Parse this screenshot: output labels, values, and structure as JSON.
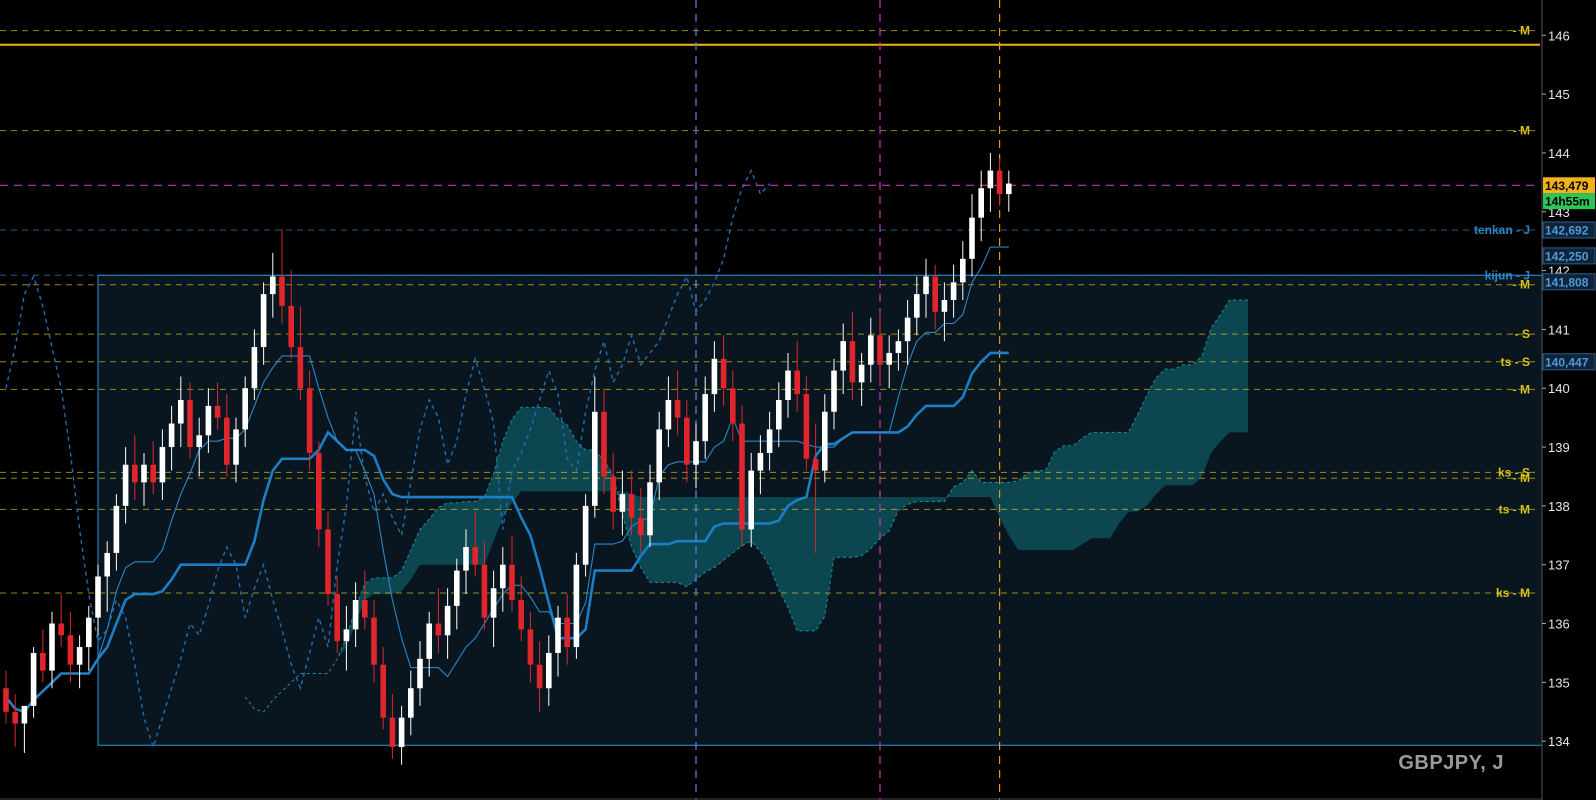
{
  "chart": {
    "symbol": "GBPJPY, J",
    "colors": {
      "background": "#000000",
      "bull": "#ffffff",
      "bear": "#e0262c",
      "kumo": "#0e6f78",
      "kijun": "#1a7fc4",
      "tenkan": "#2a86c8",
      "chikou": "#1f6fb5",
      "range_box": "#1f7fb8",
      "resistance": "#f3b21a"
    },
    "y_axis": {
      "min": 133.0,
      "max": 146.6,
      "ticks": [
        "146",
        "145",
        "144",
        "143",
        "142",
        "141",
        "140",
        "139",
        "138",
        "137",
        "136",
        "135",
        "134"
      ]
    },
    "price_tags": [
      {
        "text": "143,479",
        "value": 143.45,
        "bg": "#f3b21a",
        "fg": "#000000"
      },
      {
        "text": "14h55m",
        "value": 143.18,
        "bg": "#2fc45a",
        "fg": "#000000"
      },
      {
        "text": "142,692",
        "value": 142.69,
        "bg": "#10233a",
        "fg": "#4d9bd8"
      },
      {
        "text": "142,250",
        "value": 142.25,
        "bg": "#10233a",
        "fg": "#4d9bd8"
      },
      {
        "text": "141,808",
        "value": 141.81,
        "bg": "#10233a",
        "fg": "#4d9bd8"
      },
      {
        "text": "140,447",
        "value": 140.45,
        "bg": "#10233a",
        "fg": "#4d9bd8"
      }
    ],
    "levels": [
      {
        "label": "- M",
        "value": 146.08,
        "color": "#d9c21a"
      },
      {
        "label": "- M",
        "value": 144.38,
        "color": "#d9c21a"
      },
      {
        "label": "tenkan - J",
        "value": 142.69,
        "color": "#2a86c8"
      },
      {
        "label": "kijun - J",
        "value": 141.92,
        "color": "#2a86c8"
      },
      {
        "label": "- M",
        "value": 141.76,
        "color": "#d9c21a"
      },
      {
        "label": "- S",
        "value": 140.92,
        "color": "#d9c21a"
      },
      {
        "label": "ts - S",
        "value": 140.45,
        "color": "#d9c21a"
      },
      {
        "label": "- M",
        "value": 139.98,
        "color": "#d9c21a"
      },
      {
        "label": "ks - S",
        "value": 138.57,
        "color": "#d9c21a"
      },
      {
        "label": "- M",
        "value": 138.47,
        "color": "#d9c21a"
      },
      {
        "label": "ts - M",
        "value": 137.94,
        "color": "#d9c21a"
      },
      {
        "label": "ks - M",
        "value": 136.52,
        "color": "#d9c21a"
      }
    ],
    "resistance_line": 145.84,
    "magenta_hline": 143.45,
    "vlines": [
      {
        "bar": 75,
        "color": "#6a7fd8"
      },
      {
        "bar": 95,
        "color": "#d030c0"
      },
      {
        "bar": 108,
        "color": "#e39a1c"
      }
    ],
    "range_box": {
      "bar_start": 10,
      "bar_end": 168,
      "top": 141.92,
      "bottom": 133.93
    },
    "kijun_tail": {
      "bar_start": 106,
      "bar_end": 113,
      "value": 141.81
    },
    "tenkan_tail": {
      "bar_start": 111,
      "bar_end": 113,
      "value": 142.69
    }
  },
  "chart_data": {
    "type": "candlestick",
    "title": "GBPJPY, J",
    "ylim": [
      133.0,
      146.6
    ],
    "y_ticks": [
      134,
      135,
      136,
      137,
      138,
      139,
      140,
      141,
      142,
      143,
      144,
      145,
      146
    ],
    "x_labels": [],
    "last_price": 143.479,
    "candles": [
      [
        134.9,
        135.2,
        134.3,
        134.5
      ],
      [
        134.5,
        134.8,
        133.9,
        134.3
      ],
      [
        134.3,
        134.6,
        133.8,
        134.6
      ],
      [
        134.6,
        135.6,
        134.4,
        135.5
      ],
      [
        135.5,
        135.9,
        135.0,
        135.2
      ],
      [
        135.2,
        136.2,
        134.9,
        136.0
      ],
      [
        136.0,
        136.5,
        135.6,
        135.8
      ],
      [
        135.8,
        136.2,
        135.0,
        135.3
      ],
      [
        135.3,
        135.8,
        134.9,
        135.6
      ],
      [
        135.6,
        136.3,
        135.2,
        136.1
      ],
      [
        136.1,
        137.0,
        135.8,
        136.8
      ],
      [
        136.8,
        137.4,
        136.2,
        137.2
      ],
      [
        137.2,
        138.2,
        136.9,
        138.0
      ],
      [
        138.0,
        139.0,
        137.7,
        138.7
      ],
      [
        138.7,
        139.2,
        138.1,
        138.4
      ],
      [
        138.4,
        138.9,
        138.0,
        138.7
      ],
      [
        138.7,
        139.1,
        138.2,
        138.4
      ],
      [
        138.4,
        139.3,
        138.1,
        139.0
      ],
      [
        139.0,
        139.7,
        138.6,
        139.4
      ],
      [
        139.4,
        140.2,
        139.0,
        139.8
      ],
      [
        139.8,
        140.1,
        138.8,
        139.0
      ],
      [
        139.0,
        139.5,
        138.5,
        139.2
      ],
      [
        139.2,
        140.0,
        138.9,
        139.7
      ],
      [
        139.7,
        140.1,
        139.3,
        139.5
      ],
      [
        139.5,
        139.9,
        138.5,
        138.7
      ],
      [
        138.7,
        139.5,
        138.4,
        139.3
      ],
      [
        139.3,
        140.2,
        139.0,
        140.0
      ],
      [
        140.0,
        141.0,
        139.8,
        140.7
      ],
      [
        140.7,
        141.8,
        140.4,
        141.6
      ],
      [
        141.6,
        142.3,
        141.2,
        141.9
      ],
      [
        141.9,
        142.7,
        141.1,
        141.4
      ],
      [
        141.4,
        142.0,
        140.5,
        140.7
      ],
      [
        140.7,
        141.4,
        139.8,
        140.0
      ],
      [
        140.0,
        140.3,
        138.6,
        138.9
      ],
      [
        138.9,
        139.1,
        137.3,
        137.6
      ],
      [
        137.6,
        137.9,
        136.3,
        136.5
      ],
      [
        136.5,
        136.8,
        135.5,
        135.7
      ],
      [
        135.7,
        136.3,
        135.2,
        135.9
      ],
      [
        135.9,
        136.7,
        135.6,
        136.4
      ],
      [
        136.4,
        136.9,
        135.9,
        136.1
      ],
      [
        136.1,
        136.4,
        135.0,
        135.3
      ],
      [
        135.3,
        135.6,
        134.2,
        134.4
      ],
      [
        134.4,
        134.8,
        133.7,
        133.9
      ],
      [
        133.9,
        134.6,
        133.6,
        134.4
      ],
      [
        134.4,
        135.2,
        134.1,
        134.9
      ],
      [
        134.9,
        135.7,
        134.6,
        135.4
      ],
      [
        135.4,
        136.2,
        135.1,
        136.0
      ],
      [
        136.0,
        136.6,
        135.5,
        135.8
      ],
      [
        135.8,
        136.6,
        135.4,
        136.3
      ],
      [
        136.3,
        137.1,
        135.9,
        136.9
      ],
      [
        136.9,
        137.6,
        136.5,
        137.3
      ],
      [
        137.3,
        137.9,
        136.8,
        137.0
      ],
      [
        137.0,
        137.4,
        135.9,
        136.1
      ],
      [
        136.1,
        136.9,
        135.6,
        136.6
      ],
      [
        136.6,
        137.3,
        136.2,
        137.0
      ],
      [
        137.0,
        137.5,
        136.2,
        136.4
      ],
      [
        136.4,
        136.8,
        135.7,
        135.9
      ],
      [
        135.9,
        136.2,
        135.0,
        135.3
      ],
      [
        135.3,
        135.7,
        134.5,
        134.9
      ],
      [
        134.9,
        135.8,
        134.6,
        135.5
      ],
      [
        135.5,
        136.3,
        135.1,
        136.1
      ],
      [
        136.1,
        136.5,
        135.3,
        135.6
      ],
      [
        135.6,
        137.2,
        135.4,
        137.0
      ],
      [
        137.0,
        138.2,
        136.8,
        138.0
      ],
      [
        138.0,
        140.2,
        137.8,
        139.6
      ],
      [
        139.6,
        140.0,
        138.2,
        138.5
      ],
      [
        138.5,
        138.9,
        137.6,
        137.9
      ],
      [
        137.9,
        138.6,
        137.5,
        138.2
      ],
      [
        138.2,
        138.6,
        137.5,
        137.8
      ],
      [
        137.8,
        138.3,
        137.2,
        137.5
      ],
      [
        137.5,
        138.7,
        137.3,
        138.4
      ],
      [
        138.4,
        139.6,
        138.1,
        139.3
      ],
      [
        139.3,
        140.2,
        139.0,
        139.8
      ],
      [
        139.8,
        140.3,
        139.2,
        139.5
      ],
      [
        139.5,
        139.8,
        138.4,
        138.7
      ],
      [
        138.7,
        139.4,
        138.3,
        139.1
      ],
      [
        139.1,
        140.2,
        138.8,
        139.9
      ],
      [
        139.9,
        140.8,
        139.6,
        140.5
      ],
      [
        140.5,
        140.9,
        139.7,
        140.0
      ],
      [
        140.0,
        140.3,
        139.1,
        139.4
      ],
      [
        139.4,
        139.7,
        137.3,
        137.6
      ],
      [
        137.6,
        138.9,
        137.3,
        138.6
      ],
      [
        138.6,
        139.2,
        138.2,
        138.9
      ],
      [
        138.9,
        139.6,
        138.6,
        139.3
      ],
      [
        139.3,
        140.1,
        139.0,
        139.8
      ],
      [
        139.8,
        140.6,
        139.5,
        140.3
      ],
      [
        140.3,
        140.8,
        139.6,
        139.9
      ],
      [
        139.9,
        140.2,
        138.6,
        138.8
      ],
      [
        138.8,
        139.4,
        137.2,
        138.6
      ],
      [
        138.6,
        139.9,
        138.4,
        139.6
      ],
      [
        139.6,
        140.5,
        139.3,
        140.3
      ],
      [
        140.3,
        141.1,
        139.9,
        140.8
      ],
      [
        140.8,
        141.3,
        139.8,
        140.1
      ],
      [
        140.1,
        140.6,
        139.7,
        140.4
      ],
      [
        140.4,
        141.2,
        140.1,
        140.9
      ],
      [
        140.9,
        141.3,
        140.1,
        140.4
      ],
      [
        140.4,
        140.9,
        140.0,
        140.6
      ],
      [
        140.6,
        141.0,
        140.3,
        140.8
      ],
      [
        140.8,
        141.5,
        140.4,
        141.2
      ],
      [
        141.2,
        141.9,
        140.9,
        141.6
      ],
      [
        141.6,
        142.2,
        141.2,
        141.9
      ],
      [
        141.9,
        142.1,
        141.0,
        141.3
      ],
      [
        141.3,
        141.8,
        140.8,
        141.5
      ],
      [
        141.5,
        142.1,
        141.2,
        141.8
      ],
      [
        141.8,
        142.5,
        141.5,
        142.2
      ],
      [
        142.2,
        143.3,
        141.9,
        142.9
      ],
      [
        142.9,
        143.7,
        142.5,
        143.4
      ],
      [
        143.4,
        144.0,
        143.0,
        143.7
      ],
      [
        143.7,
        143.9,
        143.1,
        143.3
      ],
      [
        143.3,
        143.7,
        143.0,
        143.479
      ]
    ]
  }
}
